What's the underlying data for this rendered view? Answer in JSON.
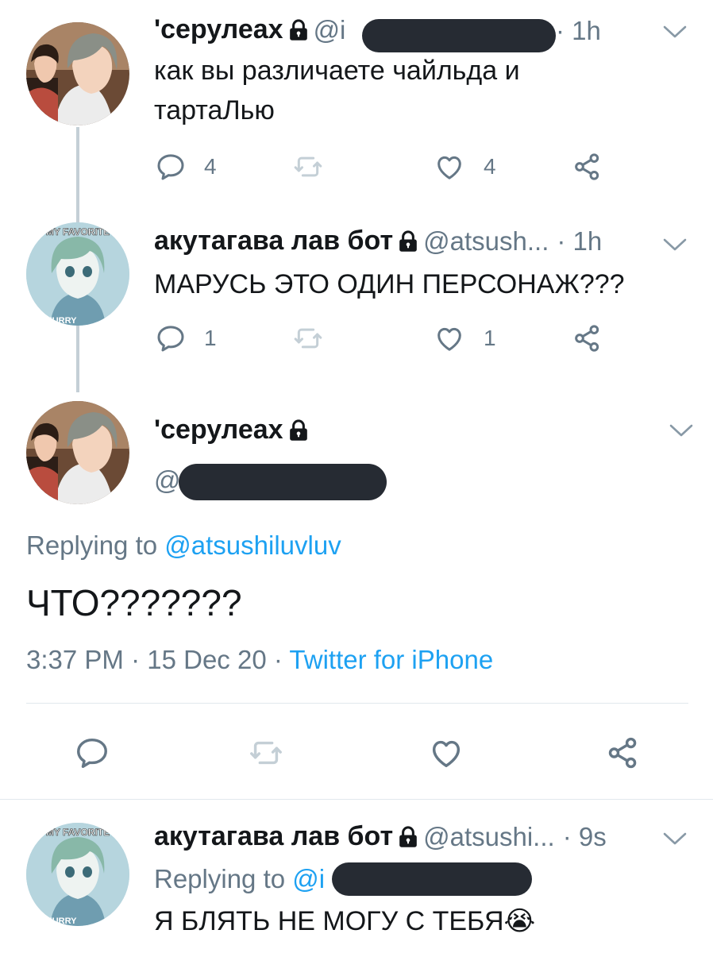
{
  "colors": {
    "accent": "#1da1f2",
    "secondary": "#657786",
    "divider": "#e1e8ed"
  },
  "tweet1": {
    "display_name": "'серулеах",
    "handle_prefix": "@i",
    "time": "· 1h",
    "text": "как вы различаете чайльда и тартаЛью",
    "line1": "как вы различаете чайльда и",
    "line2": "тартаЛью",
    "reply_count": "4",
    "like_count": "4"
  },
  "tweet2": {
    "display_name": "акутагава лав бот",
    "handle": "@atsush...",
    "time": "· 1h",
    "text": "МАРУСЬ ЭТО ОДИН ПЕРСОНАЖ???",
    "reply_count": "1",
    "like_count": "1",
    "avatar_text_top": "MY FAVORITE",
    "avatar_text_bottom": "FURRY"
  },
  "main_tweet": {
    "display_name": "'серулеах",
    "handle_prefix": "@",
    "replying_label": "Replying to",
    "replying_to": "@atsushiluvluv",
    "text": "ЧТО???????",
    "time": "3:37 PM",
    "date": "· 15 Dec 20 ·",
    "source": "Twitter for iPhone"
  },
  "tweet4": {
    "display_name": "акутагава лав бот",
    "handle": "@atsushi...",
    "time": "· 9s",
    "replying_label": "Replying to",
    "replying_prefix": "@i",
    "text": "Я БЛЯТЬ НЕ МОГУ С ТЕБЯ",
    "emoji": "😭",
    "avatar_text_top": "MY FAVORITE",
    "avatar_text_bottom": "FURRY"
  },
  "icons": [
    "reply-icon",
    "retweet-icon",
    "like-icon",
    "share-icon",
    "lock-icon",
    "chevron-down-icon"
  ]
}
